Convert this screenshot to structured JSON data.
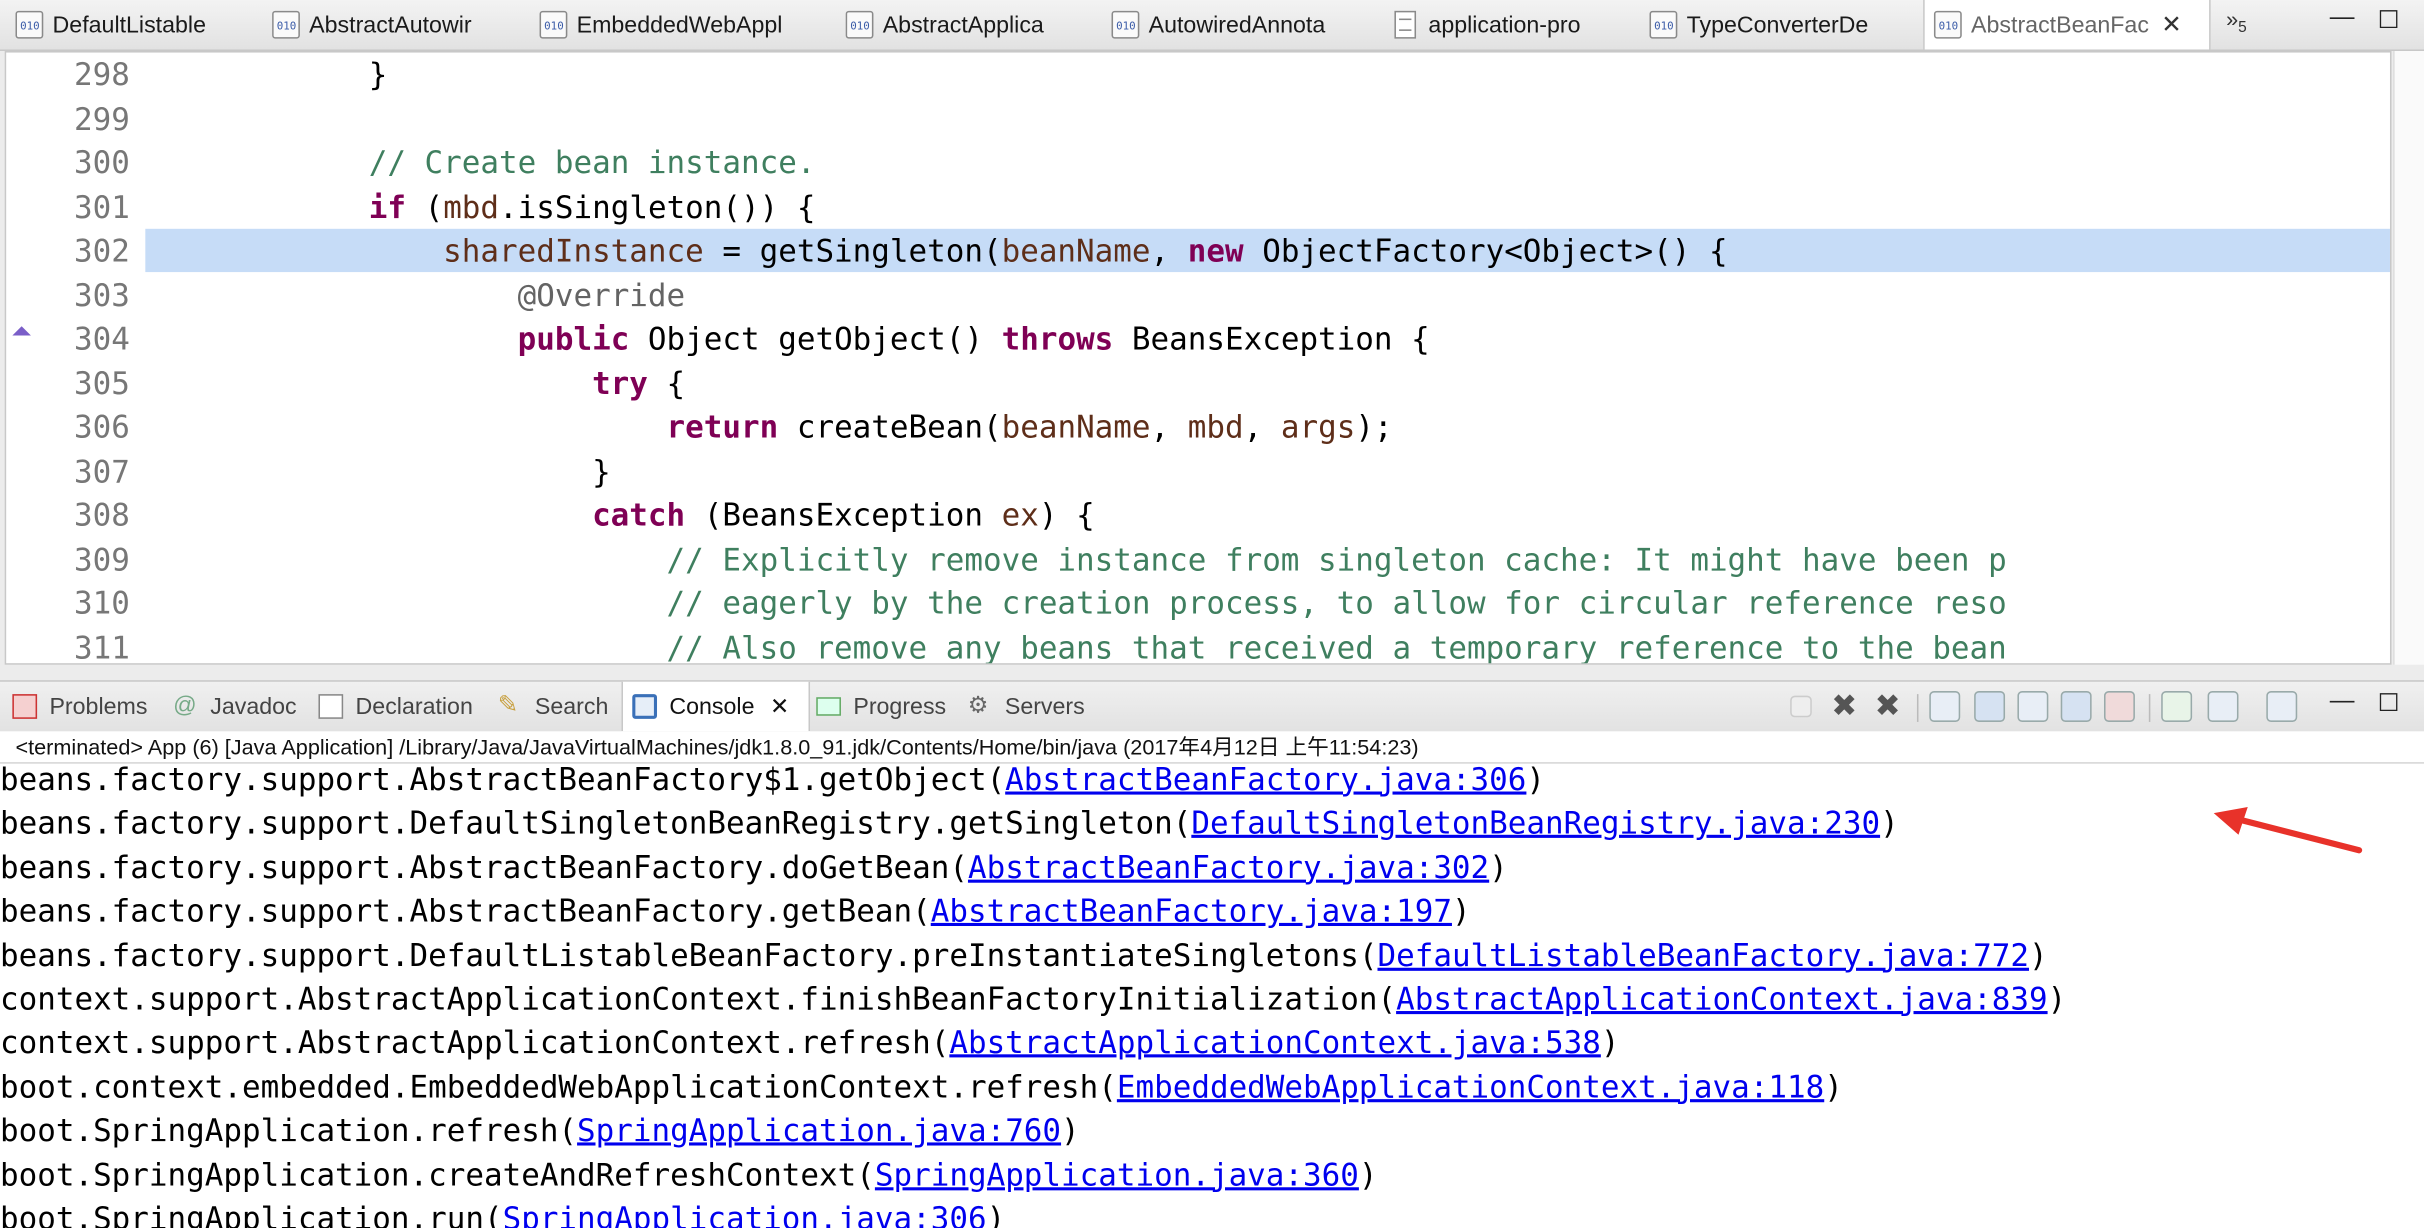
{
  "editor_tabs": [
    {
      "label": "DefaultListable",
      "icon": "class-file-icon"
    },
    {
      "label": "AbstractAutowir",
      "icon": "class-file-icon"
    },
    {
      "label": "EmbeddedWebAppl",
      "icon": "class-file-icon"
    },
    {
      "label": "AbstractApplica",
      "icon": "class-file-icon"
    },
    {
      "label": "AutowiredAnnota",
      "icon": "class-file-icon"
    },
    {
      "label": "application-pro",
      "icon": "properties-file-icon"
    },
    {
      "label": "TypeConverterDe",
      "icon": "class-file-icon"
    },
    {
      "label": "AbstractBeanFac",
      "icon": "class-file-icon",
      "active": true
    }
  ],
  "tab_overflow": {
    "glyph": "»",
    "count": "5"
  },
  "window_controls": {
    "minimize": "—",
    "maximize": "☐"
  },
  "editor": {
    "lines": [
      {
        "no": "298",
        "indent": "            ",
        "tokens": [
          [
            "t",
            "}"
          ]
        ]
      },
      {
        "no": "299",
        "indent": "",
        "tokens": []
      },
      {
        "no": "300",
        "indent": "            ",
        "tokens": [
          [
            "cm",
            "// Create bean instance."
          ]
        ]
      },
      {
        "no": "301",
        "indent": "            ",
        "tokens": [
          [
            "kw",
            "if"
          ],
          [
            "t",
            " ("
          ],
          [
            "fld",
            "mbd"
          ],
          [
            "t",
            ".isSingleton()) {"
          ]
        ]
      },
      {
        "no": "302",
        "indent": "                ",
        "highlight": true,
        "tokens": [
          [
            "fld",
            "sharedInstance"
          ],
          [
            "t",
            " = getSingleton("
          ],
          [
            "fld",
            "beanName"
          ],
          [
            "t",
            ", "
          ],
          [
            "kw",
            "new"
          ],
          [
            "t",
            " ObjectFactory<Object>() {"
          ]
        ]
      },
      {
        "no": "303",
        "indent": "                    ",
        "tokens": [
          [
            "an",
            "@Override"
          ]
        ]
      },
      {
        "no": "304",
        "indent": "                    ",
        "tokens": [
          [
            "kw",
            "public"
          ],
          [
            "t",
            " Object getObject() "
          ],
          [
            "kw",
            "throws"
          ],
          [
            "t",
            " BeansException {"
          ]
        ]
      },
      {
        "no": "305",
        "indent": "                        ",
        "tokens": [
          [
            "kw",
            "try"
          ],
          [
            "t",
            " {"
          ]
        ]
      },
      {
        "no": "306",
        "indent": "                            ",
        "tokens": [
          [
            "kw",
            "return"
          ],
          [
            "t",
            " createBean("
          ],
          [
            "fld",
            "beanName"
          ],
          [
            "t",
            ", "
          ],
          [
            "fld",
            "mbd"
          ],
          [
            "t",
            ", "
          ],
          [
            "fld",
            "args"
          ],
          [
            "t",
            ");"
          ]
        ]
      },
      {
        "no": "307",
        "indent": "                        ",
        "tokens": [
          [
            "t",
            "}"
          ]
        ]
      },
      {
        "no": "308",
        "indent": "                        ",
        "tokens": [
          [
            "kw",
            "catch"
          ],
          [
            "t",
            " (BeansException "
          ],
          [
            "fld",
            "ex"
          ],
          [
            "t",
            ") {"
          ]
        ]
      },
      {
        "no": "309",
        "indent": "                            ",
        "tokens": [
          [
            "cm",
            "// Explicitly remove instance from singleton cache: It might have been p"
          ]
        ]
      },
      {
        "no": "310",
        "indent": "                            ",
        "tokens": [
          [
            "cm",
            "// eagerly by the creation process, to allow for circular reference reso"
          ]
        ]
      },
      {
        "no": "311",
        "indent": "                            ",
        "tokens": [
          [
            "cm",
            "// Also remove any beans that received a temporary reference to the bean"
          ]
        ]
      }
    ]
  },
  "view_tabs": [
    {
      "label": "Problems",
      "icon": "problems-icon"
    },
    {
      "label": "Javadoc",
      "icon": "javadoc-icon"
    },
    {
      "label": "Declaration",
      "icon": "declaration-icon"
    },
    {
      "label": "Search",
      "icon": "search-icon"
    },
    {
      "label": "Console",
      "icon": "console-icon",
      "active": true
    },
    {
      "label": "Progress",
      "icon": "progress-icon"
    },
    {
      "label": "Servers",
      "icon": "servers-icon"
    }
  ],
  "console": {
    "status": "<terminated> App (6) [Java Application] /Library/Java/JavaVirtualMachines/jdk1.8.0_91.jdk/Contents/Home/bin/java (2017年4月12日 上午11:54:23)",
    "lines": [
      {
        "prefix": "beans.factory.support.AbstractBeanFactory$1.getObject(",
        "link": "AbstractBeanFactory.java:306",
        "suffix": ")"
      },
      {
        "prefix": "beans.factory.support.DefaultSingletonBeanRegistry.getSingleton(",
        "link": "DefaultSingletonBeanRegistry.java:230",
        "suffix": ")"
      },
      {
        "prefix": "beans.factory.support.AbstractBeanFactory.doGetBean(",
        "link": "AbstractBeanFactory.java:302",
        "suffix": ")"
      },
      {
        "prefix": "beans.factory.support.AbstractBeanFactory.getBean(",
        "link": "AbstractBeanFactory.java:197",
        "suffix": ")"
      },
      {
        "prefix": "beans.factory.support.DefaultListableBeanFactory.preInstantiateSingletons(",
        "link": "DefaultListableBeanFactory.java:772",
        "suffix": ")"
      },
      {
        "prefix": "context.support.AbstractApplicationContext.finishBeanFactoryInitialization(",
        "link": "AbstractApplicationContext.java:839",
        "suffix": ")"
      },
      {
        "prefix": "context.support.AbstractApplicationContext.refresh(",
        "link": "AbstractApplicationContext.java:538",
        "suffix": ")"
      },
      {
        "prefix": "boot.context.embedded.EmbeddedWebApplicationContext.refresh(",
        "link": "EmbeddedWebApplicationContext.java:118",
        "suffix": ")"
      },
      {
        "prefix": "boot.SpringApplication.refresh(",
        "link": "SpringApplication.java:760",
        "suffix": ")"
      },
      {
        "prefix": "boot.SpringApplication.createAndRefreshContext(",
        "link": "SpringApplication.java:360",
        "suffix": ")"
      },
      {
        "prefix": "boot.SpringApplication.run(",
        "link": "SpringApplication.java:306",
        "suffix": ")"
      }
    ]
  },
  "colors": {
    "keyword": "#7f0055",
    "comment": "#3f7f5f",
    "field": "#5e2e19",
    "annotation": "#646464",
    "link": "#0000ee",
    "highlight": "#c6dcf7",
    "arrow": "#e8322a"
  }
}
